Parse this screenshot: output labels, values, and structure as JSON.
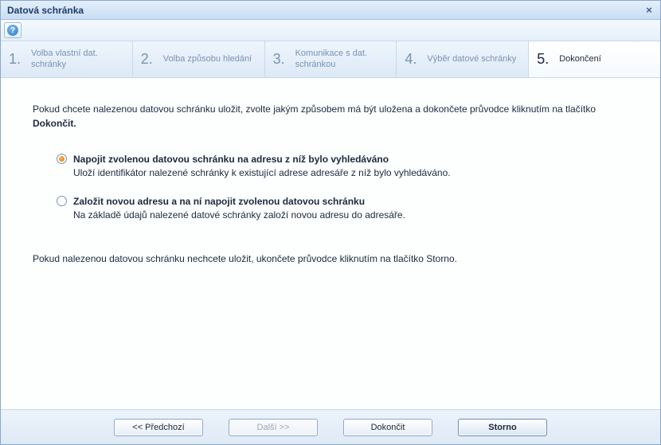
{
  "window": {
    "title": "Datová schránka",
    "close_icon": "×"
  },
  "toolbar": {
    "help_symbol": "?"
  },
  "steps": [
    {
      "num": "1.",
      "label": "Volba vlastní dat. schránky"
    },
    {
      "num": "2.",
      "label": "Volba způsobu hledání"
    },
    {
      "num": "3.",
      "label": "Komunikace s dat. schránkou"
    },
    {
      "num": "4.",
      "label": "Výběr datové schránky"
    },
    {
      "num": "5.",
      "label": "Dokončení"
    }
  ],
  "active_step_index": 4,
  "content": {
    "intro_prefix": "Pokud chcete nalezenou datovou schránku uložit, zvolte jakým způsobem má být uložena a dokončete průvodce kliknutím na tlačítko ",
    "intro_bold": "Dokončit.",
    "options": [
      {
        "checked": true,
        "title": "Napojit zvolenou datovou schránku na adresu z níž bylo vyhledáváno",
        "desc": "Uloží identifikátor nalezené schránky k existující adrese adresáře z níž bylo vyhledáváno."
      },
      {
        "checked": false,
        "title": "Založit novou adresu a na ní napojit zvolenou datovou schránku",
        "desc": "Na základě údajů nalezené datové schránky založí novou adresu do adresáře."
      }
    ],
    "outro": "Pokud nalezenou datovou schránku nechcete uložit, ukončete průvodce kliknutím na tlačítko Storno."
  },
  "buttons": {
    "prev": "<< Předchozí",
    "next": "Další >>",
    "finish": "Dokončit",
    "cancel": "Storno"
  }
}
